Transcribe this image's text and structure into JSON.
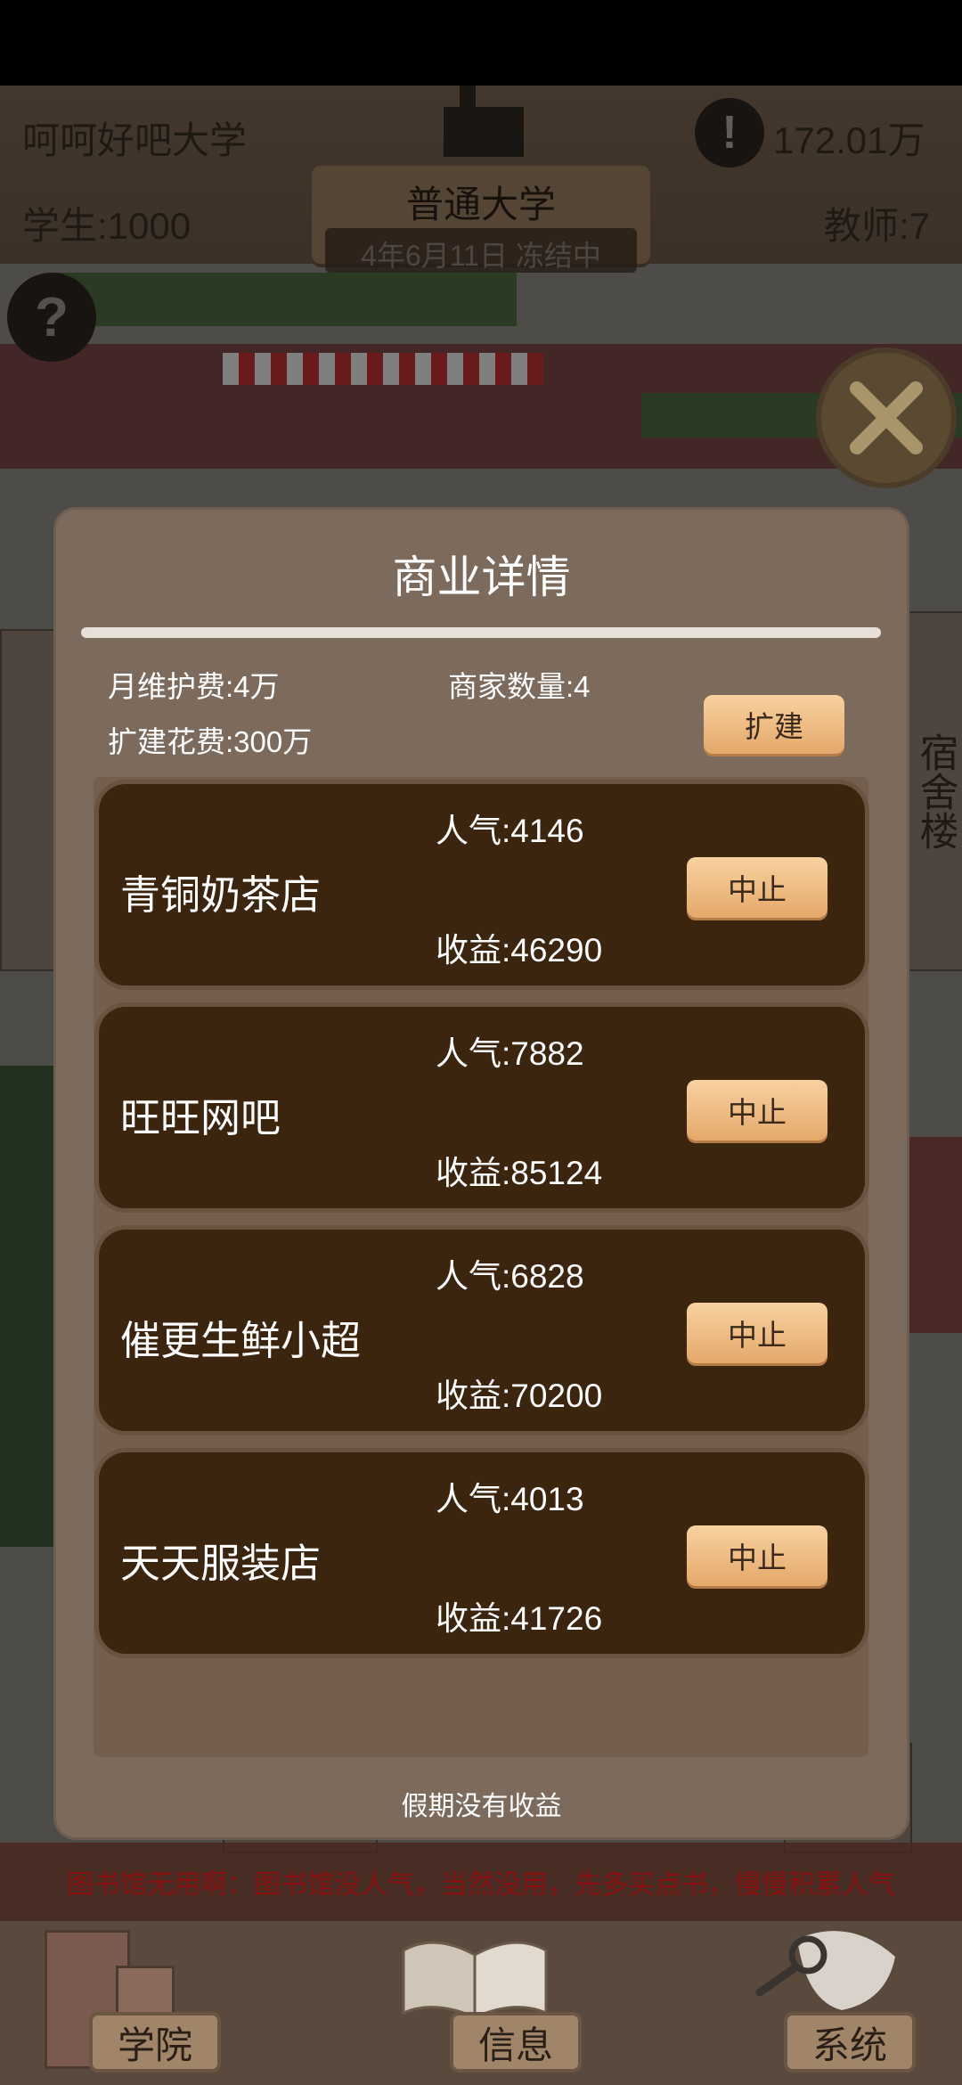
{
  "header": {
    "university_name": "呵呵好吧大学",
    "money": "172.01万",
    "students": "学生:1000",
    "teachers": "教师:7",
    "university_level": "普通大学",
    "date_status": "4年6月11日 冻结中"
  },
  "dialog": {
    "title": "商业详情",
    "monthly_fee": "月维护费:4万",
    "merchant_count": "商家数量:4",
    "expand_cost": "扩建花费:300万",
    "expand_button": "扩建",
    "shops": [
      {
        "name": "青铜奶茶店",
        "popularity": "人气:4146",
        "income": "收益:46290",
        "action": "中止"
      },
      {
        "name": "旺旺网吧",
        "popularity": "人气:7882",
        "income": "收益:85124",
        "action": "中止"
      },
      {
        "name": "催更生鲜小超",
        "popularity": "人气:6828",
        "income": "收益:70200",
        "action": "中止"
      },
      {
        "name": "天天服装店",
        "popularity": "人气:4013",
        "income": "收益:41726",
        "action": "中止"
      }
    ],
    "footer_note": "假期没有收益"
  },
  "map_label": "宿舍楼",
  "ticker": "图书馆无用啊：图书馆没人气，当然没用，先多买点书，慢慢积累人气",
  "bottom_nav": {
    "college": "学院",
    "info": "信息",
    "system": "系统"
  },
  "colors": {
    "dialog_bg": "#7c6b5c",
    "card_bg": "#3c250e",
    "button_gradient_top": "#f8d2a0",
    "ticker_text": "#8a1010"
  }
}
